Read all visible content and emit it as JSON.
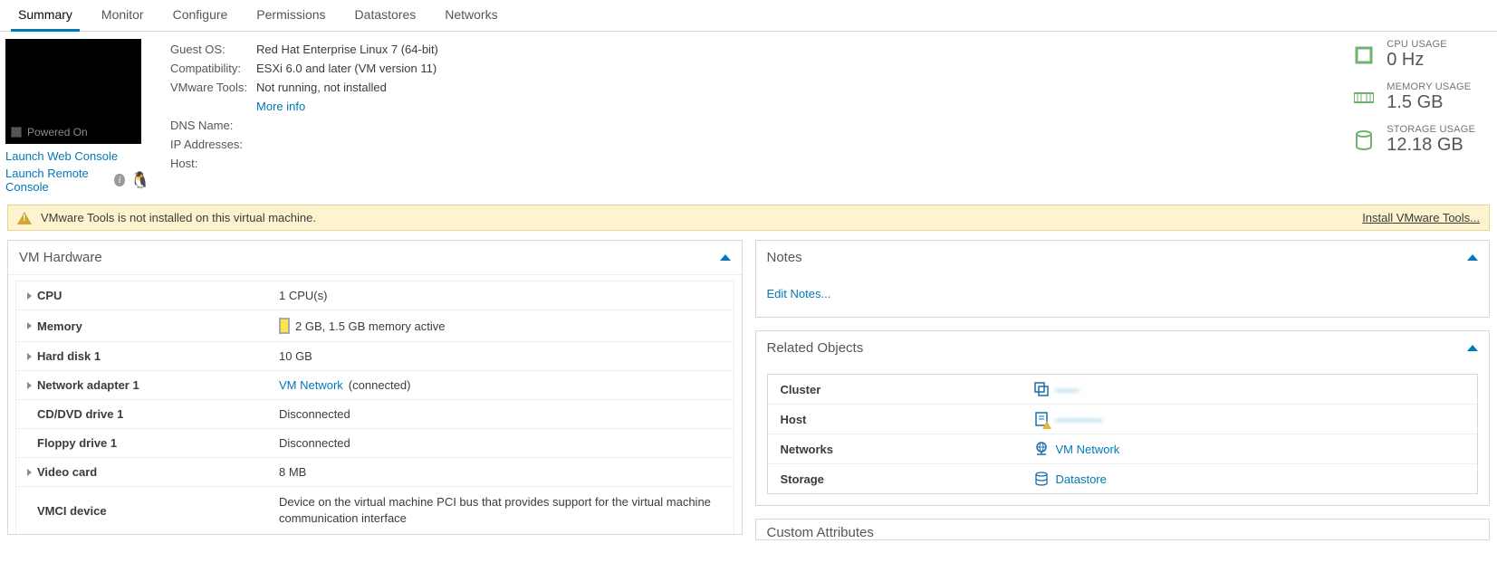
{
  "tabs": {
    "summary": "Summary",
    "monitor": "Monitor",
    "configure": "Configure",
    "permissions": "Permissions",
    "datastores": "Datastores",
    "networks": "Networks"
  },
  "thumbnail": {
    "status": "Powered On"
  },
  "consoleLinks": {
    "web": "Launch Web Console",
    "remote": "Launch Remote Console"
  },
  "vmInfo": {
    "guestOsLabel": "Guest OS:",
    "guestOsVal": "Red Hat Enterprise Linux 7 (64-bit)",
    "compatLabel": "Compatibility:",
    "compatVal": "ESXi 6.0 and later (VM version 11)",
    "toolsLabel": "VMware Tools:",
    "toolsVal": "Not running, not installed",
    "moreInfo": "More info",
    "dnsLabel": "DNS Name:",
    "dnsVal": "",
    "ipLabel": "IP Addresses:",
    "ipVal": "",
    "hostLabel": "Host:",
    "hostVal": ""
  },
  "usage": {
    "cpuLabel": "CPU USAGE",
    "cpuVal": "0 Hz",
    "memLabel": "MEMORY USAGE",
    "memVal": "1.5 GB",
    "storageLabel": "STORAGE USAGE",
    "storageVal": "12.18 GB"
  },
  "warning": {
    "text": "VMware Tools is not installed on this virtual machine.",
    "action": "Install VMware Tools..."
  },
  "panels": {
    "vmHardware": {
      "title": "VM Hardware",
      "rows": {
        "cpuLabel": "CPU",
        "cpuVal": "1 CPU(s)",
        "memLabel": "Memory",
        "memVal": "2 GB, 1.5 GB memory active",
        "hdLabel": "Hard disk 1",
        "hdVal": "10 GB",
        "netLabel": "Network adapter 1",
        "netLink": "VM Network",
        "netSuffix": " (connected)",
        "cdLabel": "CD/DVD drive 1",
        "cdVal": "Disconnected",
        "floppyLabel": "Floppy drive 1",
        "floppyVal": "Disconnected",
        "videoLabel": "Video card",
        "videoVal": "8 MB",
        "vmciLabel": "VMCI device",
        "vmciVal": "Device on the virtual machine PCI bus that provides support for the virtual machine communication interface"
      }
    },
    "notes": {
      "title": "Notes",
      "edit": "Edit Notes..."
    },
    "relatedObjects": {
      "title": "Related Objects",
      "clusterLabel": "Cluster",
      "clusterVal": "——",
      "hostLabel": "Host",
      "hostVal": "————",
      "networksLabel": "Networks",
      "networksVal": "VM Network",
      "storageLabel": "Storage",
      "storageVal": "Datastore"
    },
    "customAttributes": {
      "title": "Custom Attributes"
    }
  }
}
